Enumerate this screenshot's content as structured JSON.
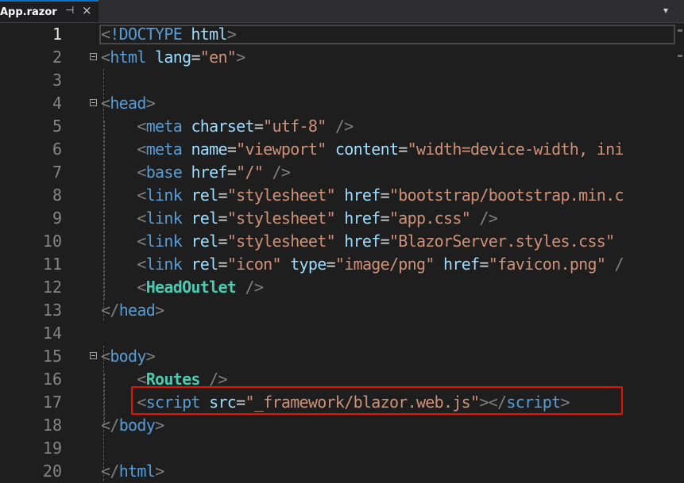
{
  "tab": {
    "title": "App.razor",
    "pin_icon": "pin-icon",
    "close_icon": "close-icon"
  },
  "editor": {
    "line_numbers": [
      "1",
      "2",
      "3",
      "4",
      "5",
      "6",
      "7",
      "8",
      "9",
      "10",
      "11",
      "12",
      "13",
      "14",
      "15",
      "16",
      "17",
      "18",
      "19",
      "20"
    ],
    "current_line": 1,
    "highlighted_line": 17,
    "colors": {
      "background": "#1e1e1e",
      "tag": "#569cd6",
      "attribute": "#9cdcfe",
      "string": "#ce9178",
      "component": "#4ec9b0",
      "punctuation": "#808080",
      "highlight_border": "#e51400"
    }
  }
}
